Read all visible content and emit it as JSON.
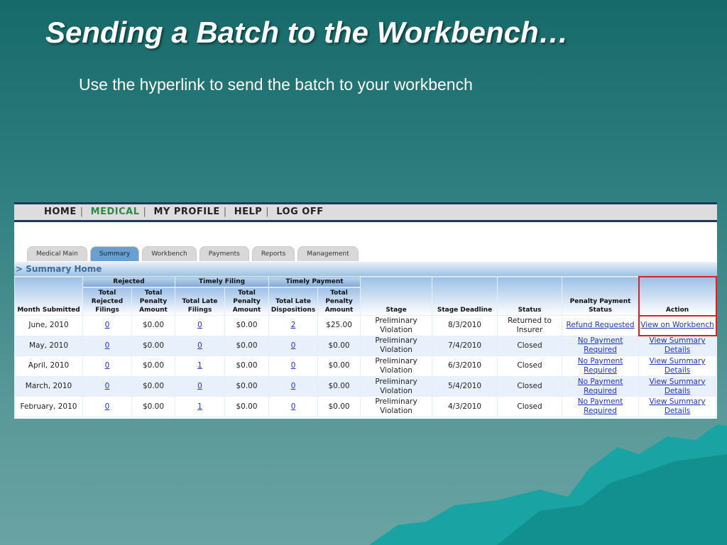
{
  "slide": {
    "title": "Sending a Batch to the Workbench…",
    "subtitle": "Use the hyperlink to send the batch to your workbench"
  },
  "nav": [
    "HOME",
    "MEDICAL",
    "MY PROFILE",
    "HELP",
    "LOG OFF"
  ],
  "tabs": [
    "Medical Main",
    "Summary",
    "Workbench",
    "Payments",
    "Reports",
    "Management"
  ],
  "breadcrumb": "> Summary Home",
  "groups": [
    "Rejected",
    "Timely Filing",
    "Timely Payment"
  ],
  "headers": [
    "Month Submitted",
    "Total Rejected Filings",
    "Total Penalty Amount",
    "Total Late Filings",
    "Total Penalty Amount",
    "Total Late Dispositions",
    "Total Penalty Amount",
    "Stage",
    "Stage Deadline",
    "Status",
    "Penalty Payment Status",
    "Action"
  ],
  "rows": [
    [
      "June, 2010",
      "0",
      "$0.00",
      "0",
      "$0.00",
      "2",
      "$25.00",
      "Preliminary Violation",
      "8/3/2010",
      "Returned to Insurer",
      "Refund Requested",
      "View on Workbench"
    ],
    [
      "May, 2010",
      "0",
      "$0.00",
      "0",
      "$0.00",
      "0",
      "$0.00",
      "Preliminary Violation",
      "7/4/2010",
      "Closed",
      "No Payment Required",
      "View Summary Details"
    ],
    [
      "April, 2010",
      "0",
      "$0.00",
      "1",
      "$0.00",
      "0",
      "$0.00",
      "Preliminary Violation",
      "6/3/2010",
      "Closed",
      "No Payment Required",
      "View Summary Details"
    ],
    [
      "March, 2010",
      "0",
      "$0.00",
      "0",
      "$0.00",
      "0",
      "$0.00",
      "Preliminary Violation",
      "5/4/2010",
      "Closed",
      "No Payment Required",
      "View Summary Details"
    ],
    [
      "February, 2010",
      "0",
      "$0.00",
      "1",
      "$0.00",
      "0",
      "$0.00",
      "Preliminary Violation",
      "4/3/2010",
      "Closed",
      "No Payment Required",
      "View Summary Details"
    ]
  ]
}
